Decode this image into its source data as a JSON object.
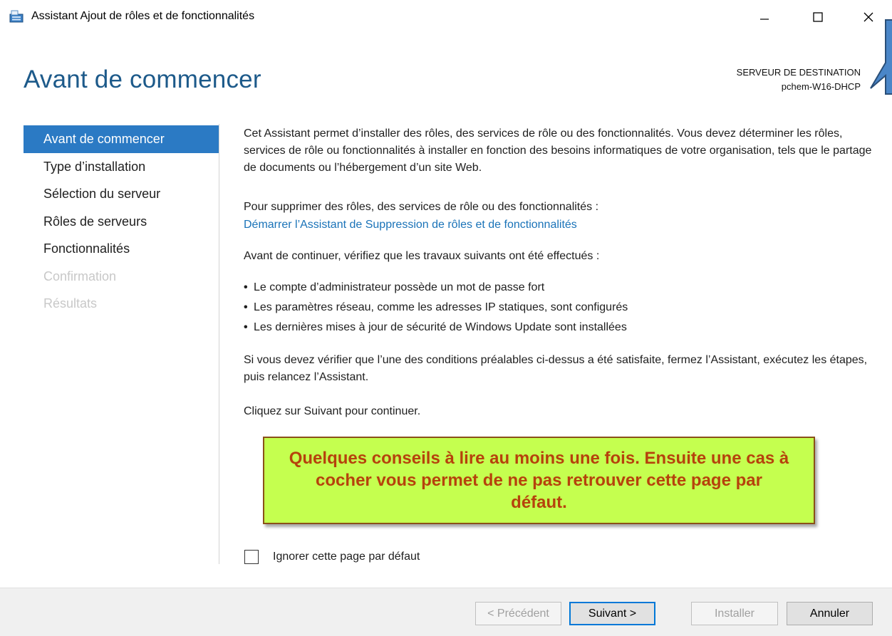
{
  "window": {
    "title": "Assistant Ajout de rôles et de fonctionnalités",
    "app_icon": "server-manager-icon"
  },
  "header": {
    "page_title": "Avant de commencer",
    "destination_label": "SERVEUR DE DESTINATION",
    "destination_server": "pchem-W16-DHCP"
  },
  "sidebar": {
    "items": [
      {
        "label": "Avant de commencer",
        "state": "active"
      },
      {
        "label": "Type d’installation",
        "state": "enabled"
      },
      {
        "label": "Sélection du serveur",
        "state": "enabled"
      },
      {
        "label": "Rôles de serveurs",
        "state": "enabled"
      },
      {
        "label": "Fonctionnalités",
        "state": "enabled"
      },
      {
        "label": "Confirmation",
        "state": "disabled"
      },
      {
        "label": "Résultats",
        "state": "disabled"
      }
    ]
  },
  "content": {
    "intro": "Cet Assistant permet d’installer des rôles, des services de rôle ou des fonctionnalités. Vous devez déterminer les rôles, services de rôle ou fonctionnalités à installer en fonction des besoins informatiques de votre organisation, tels que le partage de documents ou l’hébergement d’un site Web.",
    "remove_text": "Pour supprimer des rôles, des services de rôle ou des fonctionnalités :",
    "remove_link": "Démarrer l’Assistant de Suppression de rôles et de fonctionnalités",
    "check_text": "Avant de continuer, vérifiez que les travaux suivants ont été effectués :",
    "bullets": [
      "Le compte d’administrateur possède un mot de passe fort",
      "Les paramètres réseau, comme les adresses IP statiques, sont configurés",
      "Les dernières mises à jour de sécurité de Windows Update sont installées"
    ],
    "verify_text": "Si vous devez vérifier que l’une des conditions préalables ci-dessus a été satisfaite, fermez l’Assistant, exécutez les étapes, puis relancez l’Assistant.",
    "continue_text": "Cliquez sur Suivant pour continuer."
  },
  "note": {
    "text": "Quelques conseils à lire au moins une fois. Ensuite une cas à cocher vous permet de ne pas retrouver cette page par défaut.",
    "background": "#c5ff4f",
    "text_color": "#b6420c"
  },
  "checkbox": {
    "label": "Ignorer cette page par défaut",
    "checked": false
  },
  "footer": {
    "prev_label": "< Précédent",
    "next_label": "Suivant >",
    "install_label": "Installer",
    "cancel_label": "Annuler"
  },
  "colors": {
    "accent": "#2b7ac4",
    "title": "#1d5a8a",
    "link": "#1a73b8"
  }
}
